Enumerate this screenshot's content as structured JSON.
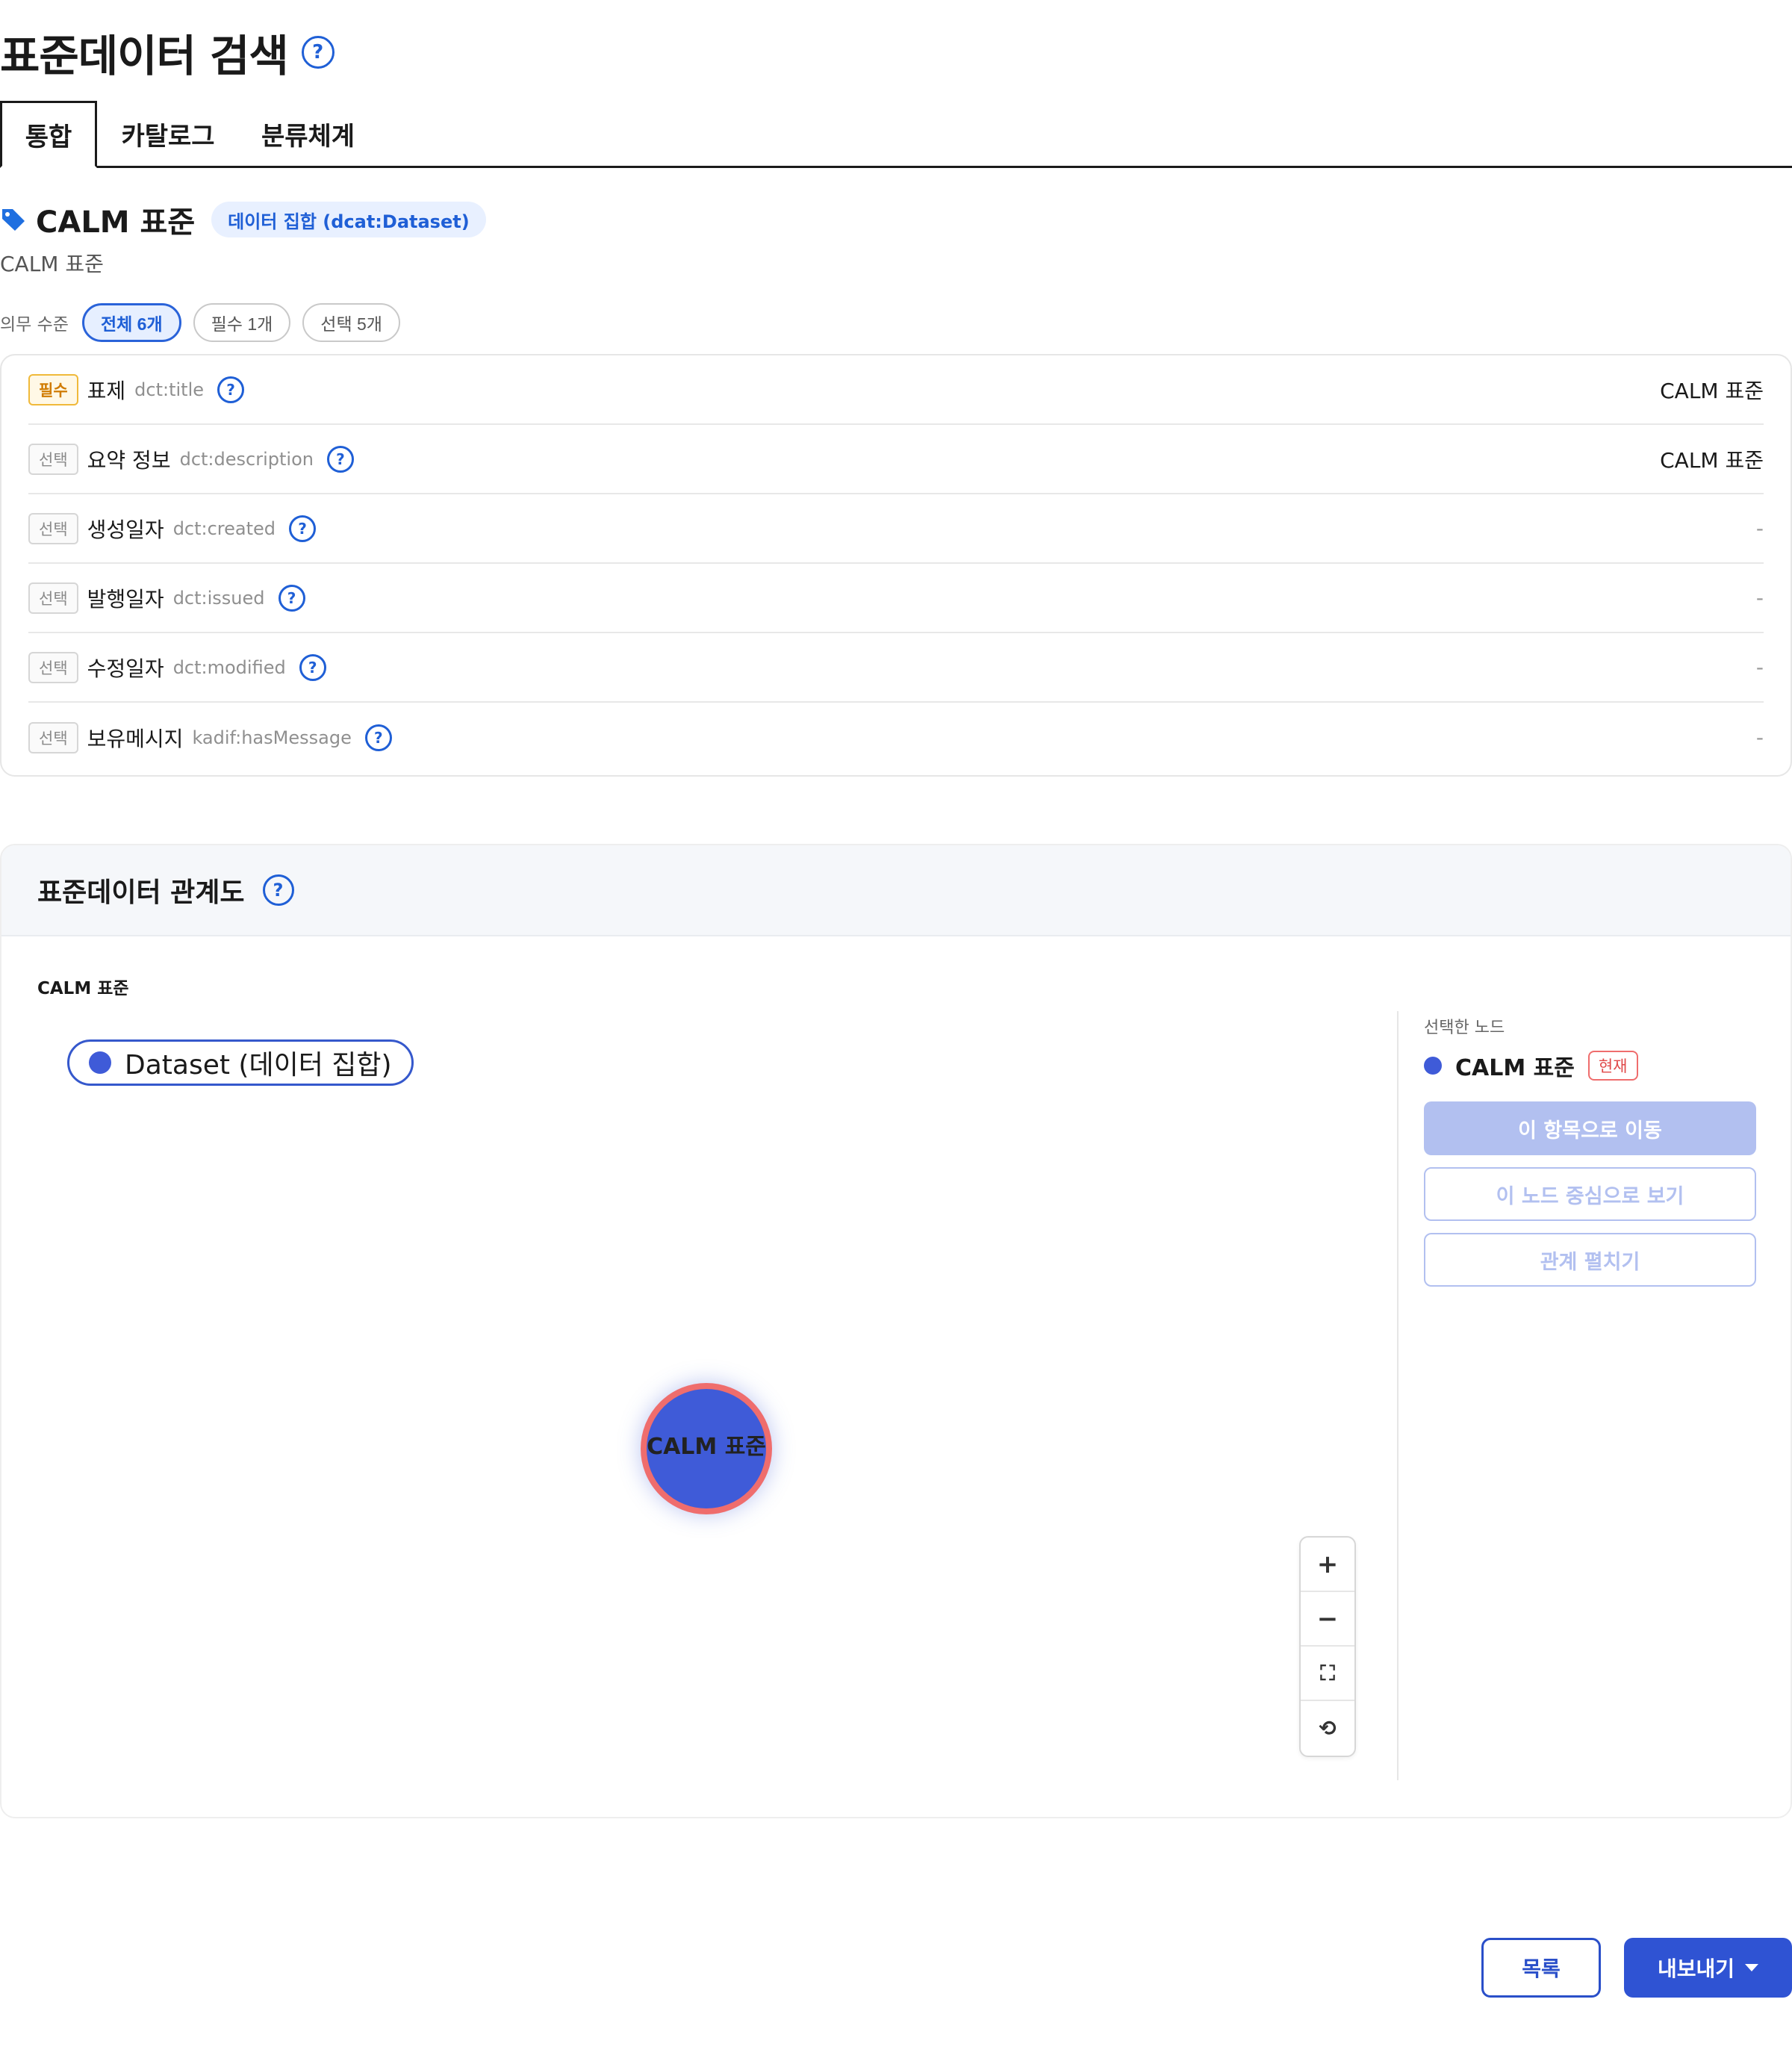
{
  "page": {
    "title": "표준데이터 검색",
    "help": "?"
  },
  "tabs": [
    {
      "label": "통합",
      "active": true
    },
    {
      "label": "카탈로그",
      "active": false
    },
    {
      "label": "분류체계",
      "active": false
    }
  ],
  "dataset": {
    "title": "CALM 표준",
    "badge": "데이터 집합 (dcat:Dataset)",
    "subtitle": "CALM 표준",
    "icon": "tag-icon"
  },
  "filter": {
    "label": "의무 수준",
    "chips": [
      "전체 6개",
      "필수 1개",
      "선택 5개"
    ],
    "active_index": 0
  },
  "properties": [
    {
      "level": "필수",
      "name": "표제",
      "key": "dct:title",
      "value": "CALM 표준"
    },
    {
      "level": "선택",
      "name": "요약 정보",
      "key": "dct:description",
      "value": "CALM 표준"
    },
    {
      "level": "선택",
      "name": "생성일자",
      "key": "dct:created",
      "value": "-"
    },
    {
      "level": "선택",
      "name": "발행일자",
      "key": "dct:issued",
      "value": "-"
    },
    {
      "level": "선택",
      "name": "수정일자",
      "key": "dct:modified",
      "value": "-"
    },
    {
      "level": "선택",
      "name": "보유메시지",
      "key": "kadif:hasMessage",
      "value": "-"
    }
  ],
  "relation": {
    "title": "표준데이터 관계도",
    "graph_label": "CALM 표준",
    "legend": "Dataset (데이터 집합)",
    "node_label": "CALM 표준",
    "zoom_controls": [
      "+",
      "−",
      "⛶",
      "⟲"
    ],
    "side": {
      "caption": "선택한 노드",
      "selected_name": "CALM 표준",
      "current_badge": "현재",
      "buttons": [
        "이 항목으로 이동",
        "이 노드 중심으로 보기",
        "관계 펼치기"
      ]
    }
  },
  "actions": {
    "list": "목록",
    "export": "내보내기"
  },
  "colors": {
    "accent": "#2f53d3",
    "node": "#3f5bd8",
    "node_border": "#ef6d6d",
    "required": "#d07b00"
  }
}
